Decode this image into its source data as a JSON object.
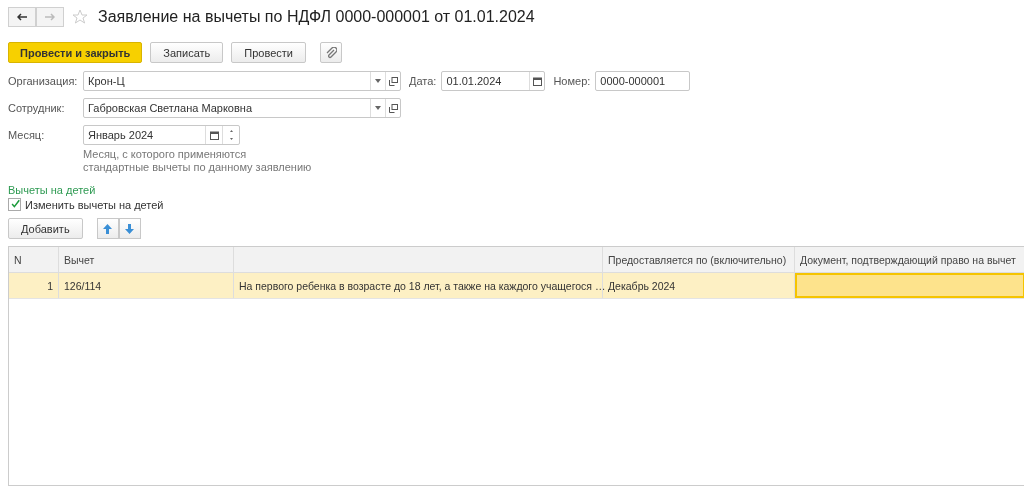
{
  "window": {
    "title": "Заявление на вычеты по НДФЛ 0000-000001 от 01.01.2024"
  },
  "toolbar": [
    {
      "label": "Провести и закрыть",
      "kind": "primary"
    },
    {
      "label": "Записать",
      "kind": "normal"
    },
    {
      "label": "Провести",
      "kind": "normal"
    },
    {
      "kind": "attach"
    }
  ],
  "fields": {
    "organization": {
      "label": "Организация:",
      "value": "Крон-Ц"
    },
    "date": {
      "label": "Дата:",
      "value": "01.01.2024"
    },
    "number": {
      "label": "Номер:",
      "value": "0000-000001"
    },
    "employee": {
      "label": "Сотрудник:",
      "value": "Габровская Светлана Марковна"
    },
    "month": {
      "label": "Месяц:",
      "value": "Январь 2024",
      "hint": "Месяц, с которого применяются стандартные вычеты по данному заявлению"
    }
  },
  "section": {
    "title": "Вычеты на детей",
    "checkbox": {
      "label": "Изменить вычеты на детей",
      "checked": true
    }
  },
  "table_toolbar": {
    "add": "Добавить"
  },
  "table": {
    "columns": [
      "N",
      "Вычет",
      "",
      "Предоставляется по (включительно)",
      "Документ, подтверждающий право на вычет"
    ],
    "rows": [
      {
        "cells": [
          "1",
          "126/114",
          "На первого ребенка в возрасте до 18 лет, а также на каждого учащегося …",
          "Декабрь 2024",
          ""
        ],
        "selected": true,
        "document_cell_active": true
      }
    ]
  }
}
